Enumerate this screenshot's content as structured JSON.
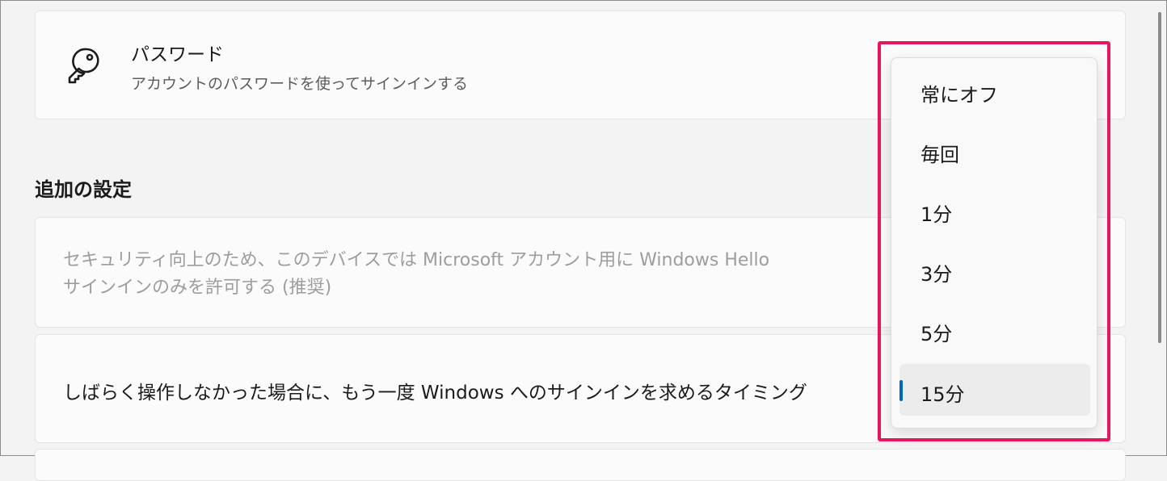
{
  "password": {
    "icon": "key-icon",
    "title": "パスワード",
    "description": "アカウントのパスワードを使ってサインインする"
  },
  "additional_settings": {
    "heading": "追加の設定",
    "security_line1": "セキュリティ向上のため、このデバイスでは Microsoft アカウント用に Windows Hello",
    "security_line2": "サインインのみを許可する (推奨)",
    "timing_label": "しばらく操作しなかった場合に、もう一度 Windows へのサインインを求めるタイミング"
  },
  "dropdown": {
    "options": [
      "常にオフ",
      "毎回",
      "1分",
      "3分",
      "5分",
      "15分"
    ],
    "selected": "15分"
  },
  "colors": {
    "highlight": "#e8175d",
    "accent": "#0067c0"
  }
}
